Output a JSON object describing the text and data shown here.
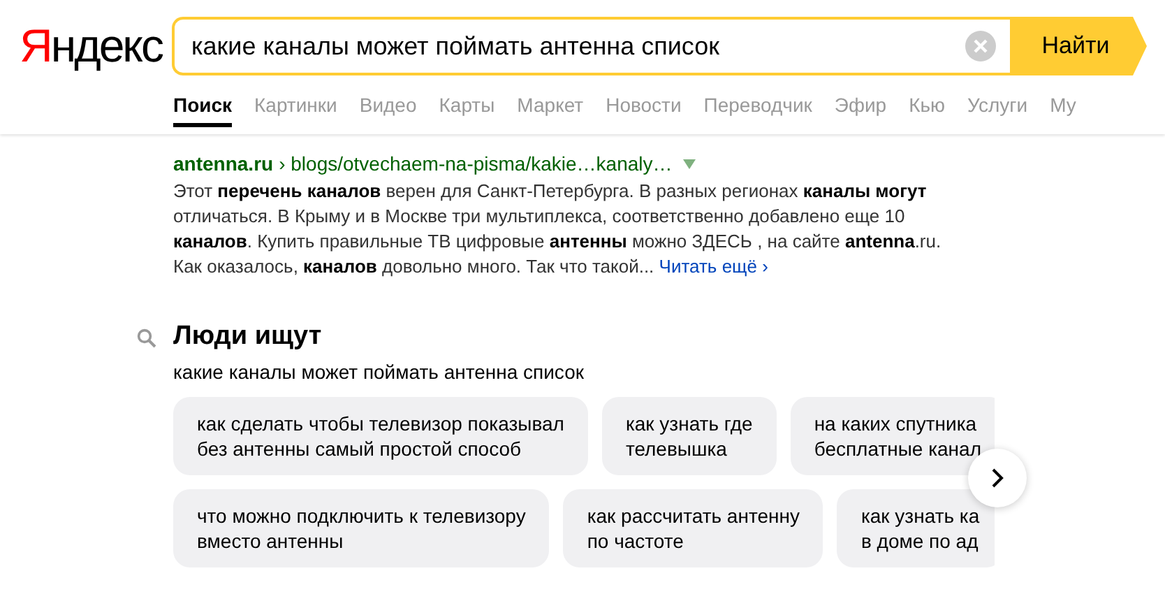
{
  "logo": "Яндекс",
  "search": {
    "value": "какие каналы может поймать антенна список",
    "button": "Найти"
  },
  "tabs": [
    {
      "label": "Поиск",
      "selected": true
    },
    {
      "label": "Картинки",
      "selected": false
    },
    {
      "label": "Видео",
      "selected": false
    },
    {
      "label": "Карты",
      "selected": false
    },
    {
      "label": "Маркет",
      "selected": false
    },
    {
      "label": "Новости",
      "selected": false
    },
    {
      "label": "Переводчик",
      "selected": false
    },
    {
      "label": "Эфир",
      "selected": false
    },
    {
      "label": "Кью",
      "selected": false
    },
    {
      "label": "Услуги",
      "selected": false
    },
    {
      "label": "Му",
      "selected": false
    }
  ],
  "result": {
    "domain": "antenna.ru",
    "path": "› blogs/otvechaem-na-pisma/kakie…kanaly…",
    "snippet": "Этот **перечень каналов** верен для Санкт-Петербурга. В разных регионах **каналы могут** отличаться. В Крыму и в Москве три мультиплекса, соответственно добавлено еще 10 **каналов**. Купить правильные ТВ цифровые **антенны** можно ЗДЕСЬ , на сайте **antenna**.ru. Как оказалось, **каналов** довольно много. Так что такой...",
    "more": "Читать ещё ›"
  },
  "people_search": {
    "title": "Люди ищут",
    "query": "какие каналы может поймать антенна список",
    "rows": [
      [
        "как сделать чтобы телевизор показывал\nбез антенны самый простой способ",
        "как узнать где\nтелевышка",
        "на каких спутника\nбесплатные канал"
      ],
      [
        "что можно подключить к телевизору\nвместо антенны",
        "как рассчитать антенну\nпо частоте",
        "как узнать ка\nв доме по ад"
      ]
    ]
  }
}
